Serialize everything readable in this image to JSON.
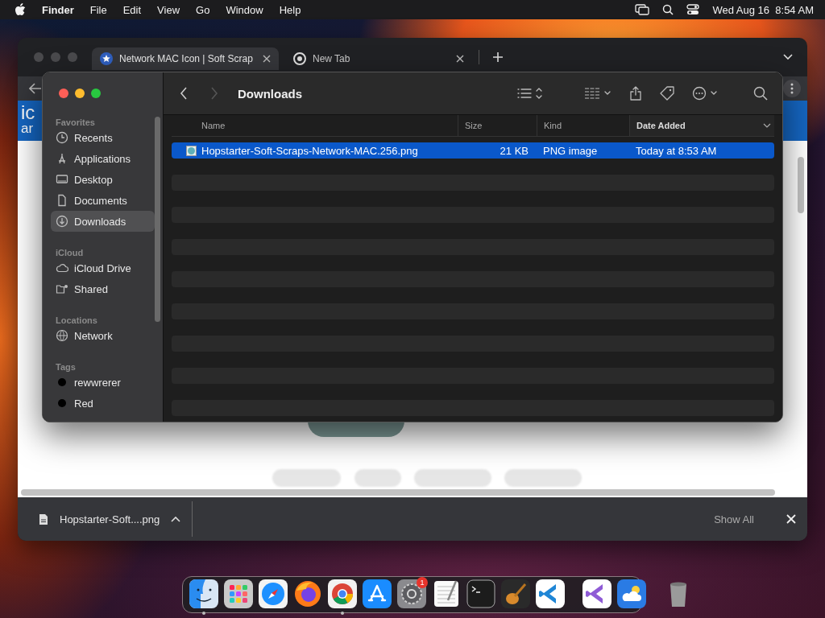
{
  "menu_bar": {
    "app_name": "Finder",
    "menus": [
      "File",
      "Edit",
      "View",
      "Go",
      "Window",
      "Help"
    ],
    "clock": "Wed Aug 16  8:54 AM"
  },
  "browser": {
    "tabs": [
      {
        "title": "Network MAC Icon | Soft Scrap",
        "selected": true
      },
      {
        "title": "New Tab",
        "selected": false
      }
    ],
    "page": {
      "logo_lines": [
        "ic",
        "ar"
      ]
    },
    "download_bar": {
      "file_name": "Hopstarter-Soft....png",
      "show_all": "Show All"
    }
  },
  "finder": {
    "title": "Downloads",
    "back_disabled": false,
    "forward_disabled": true,
    "sidebar": [
      {
        "heading": "Favorites",
        "items": [
          {
            "label": "Recents",
            "selected": false
          },
          {
            "label": "Applications",
            "selected": false
          },
          {
            "label": "Desktop",
            "selected": false
          },
          {
            "label": "Documents",
            "selected": false
          },
          {
            "label": "Downloads",
            "selected": true
          }
        ]
      },
      {
        "heading": "iCloud",
        "items": [
          {
            "label": "iCloud Drive",
            "selected": false
          },
          {
            "label": "Shared",
            "selected": false
          }
        ]
      },
      {
        "heading": "Locations",
        "items": [
          {
            "label": "Network",
            "selected": false
          }
        ]
      },
      {
        "heading": "Tags",
        "items": [
          {
            "label": "rewwrerer",
            "selected": false,
            "color": "#000000"
          },
          {
            "label": "Red",
            "selected": false,
            "color": "#000000"
          }
        ]
      }
    ],
    "columns": [
      {
        "label": "Name",
        "sorted": false
      },
      {
        "label": "Size",
        "sorted": false
      },
      {
        "label": "Kind",
        "sorted": false
      },
      {
        "label": "Date Added",
        "sorted": true
      }
    ],
    "files": [
      {
        "name": "Hopstarter-Soft-Scraps-Network-MAC.256.png",
        "size": "21 KB",
        "kind": "PNG image",
        "date_added": "Today at 8:53 AM",
        "selected": true
      }
    ]
  },
  "dock": {
    "apps": [
      {
        "running": true
      },
      {
        "running": false
      },
      {
        "running": false
      },
      {
        "running": false
      },
      {
        "running": true
      },
      {
        "running": false
      },
      {
        "running": false,
        "badge": "1"
      },
      {
        "running": false
      },
      {
        "running": false
      },
      {
        "running": false
      },
      {
        "running": false
      },
      {
        "running": false
      },
      {
        "running": false
      }
    ]
  }
}
